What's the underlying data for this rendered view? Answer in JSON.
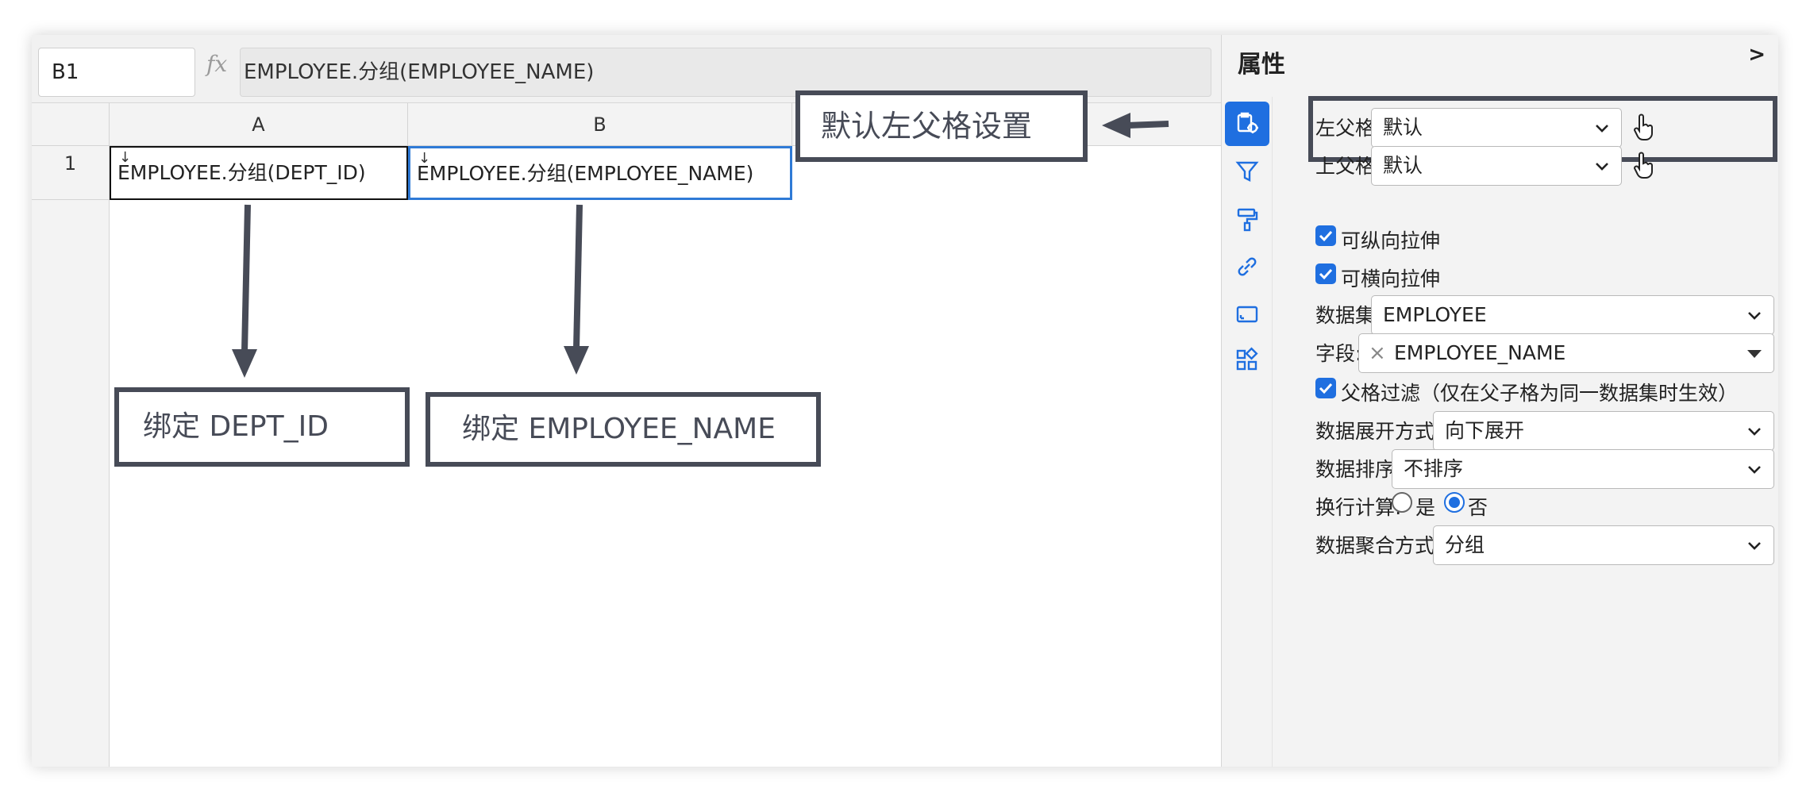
{
  "formula_bar": {
    "cell_ref": "B1",
    "fx_label": "fx",
    "formula": "EMPLOYEE.分组(EMPLOYEE_NAME)"
  },
  "grid": {
    "columns": [
      "A",
      "B"
    ],
    "rows": [
      "1"
    ],
    "cells": {
      "a1": "EMPLOYEE.分组(DEPT_ID)",
      "b1": "EMPLOYEE.分组(EMPLOYEE_NAME)"
    },
    "cell_mark": "↓"
  },
  "annotations": {
    "default_left_parent": "默认左父格设置",
    "bind_dept": "绑定 DEPT_ID",
    "bind_employee": "绑定 EMPLOYEE_NAME"
  },
  "panel": {
    "title": "属性",
    "collapse": ">",
    "rail_icons": [
      "cell-properties-icon",
      "filter-icon",
      "format-painter-icon",
      "link-icon",
      "frame-icon",
      "widgets-icon"
    ],
    "left_parent": {
      "label": "左父格:",
      "value": "默认"
    },
    "top_parent": {
      "label": "上父格:",
      "value": "默认"
    },
    "vertical_stretch": {
      "label": "可纵向拉伸",
      "checked": true
    },
    "horizontal_stretch": {
      "label": "可横向拉伸",
      "checked": true
    },
    "dataset": {
      "label": "数据集:",
      "value": "EMPLOYEE"
    },
    "field": {
      "label": "字段:",
      "value": "EMPLOYEE_NAME",
      "clear": "×"
    },
    "parent_filter": {
      "label": "父格过滤（仅在父子格为同一数据集时生效）",
      "checked": true
    },
    "expand_mode": {
      "label": "数据展开方式:",
      "value": "向下展开"
    },
    "sort": {
      "label": "数据排序:",
      "value": "不排序"
    },
    "line_calc": {
      "label": "换行计算:",
      "options": [
        "是",
        "否"
      ],
      "selected": "否"
    },
    "aggregate": {
      "label": "数据聚合方式:",
      "value": "分组"
    }
  },
  "colors": {
    "accent": "#1f6fe0",
    "annotation": "#474b57",
    "selection": "#2f7ad6"
  }
}
